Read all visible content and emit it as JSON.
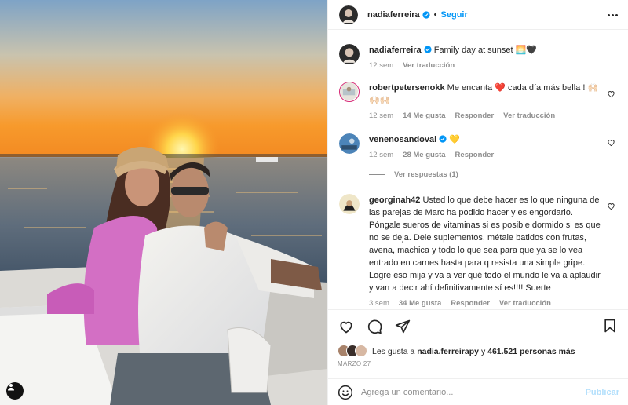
{
  "post": {
    "username": "nadiaferreira",
    "follow_label": "Seguir",
    "dot": "•"
  },
  "caption": {
    "username": "nadiaferreira",
    "text": "Family day at sunset 🌅🖤",
    "time": "12 sem",
    "translate": "Ver traducción"
  },
  "comments": [
    {
      "username": "robertpetersenokk",
      "text": "Me encanta ❤️ cada día más bella ! 🙌🏻🙌🏻🙌🏻",
      "time": "12 sem",
      "likes": "14 Me gusta",
      "reply": "Responder",
      "translate": "Ver traducción"
    },
    {
      "username": "venenosandoval",
      "text": "💛",
      "time": "12 sem",
      "likes": "28 Me gusta",
      "reply": "Responder",
      "view_replies": "Ver respuestas (1)"
    },
    {
      "username": "georginah42",
      "text": "Usted lo que debe hacer es lo que ninguna de las parejas de Marc ha podido hacer y es engordarlo. Póngale sueros de vitaminas si es posible dormido si es que no se deja. Dele suplementos, métale batidos con frutas, avena, machica y todo lo que sea para que ya se lo vea entrado en carnes hasta para q resista una simple gripe. Logre eso mija y va a ver qué todo el mundo le va a aplaudir y van a decir ahí definitivamente sí es!!!! Suerte",
      "time": "3 sem",
      "likes": "34 Me gusta",
      "reply": "Responder",
      "translate": "Ver traducción"
    }
  ],
  "likes_summary": {
    "prefix": "Les gusta a",
    "user": "nadia.ferreirapy",
    "middle": "y",
    "count": "461.521 personas más"
  },
  "date": "MARZO 27",
  "add_comment": {
    "placeholder": "Agrega un comentario...",
    "publish": "Publicar"
  },
  "colors": {
    "accent": "#0095f6",
    "publish_disabled": "#b2dffc",
    "heart_red": "#ed4956"
  },
  "icons": [
    "verified-icon",
    "more-options-icon",
    "heart-icon",
    "comment-icon",
    "share-icon",
    "save-icon",
    "emoji-icon",
    "tag-people-icon"
  ]
}
